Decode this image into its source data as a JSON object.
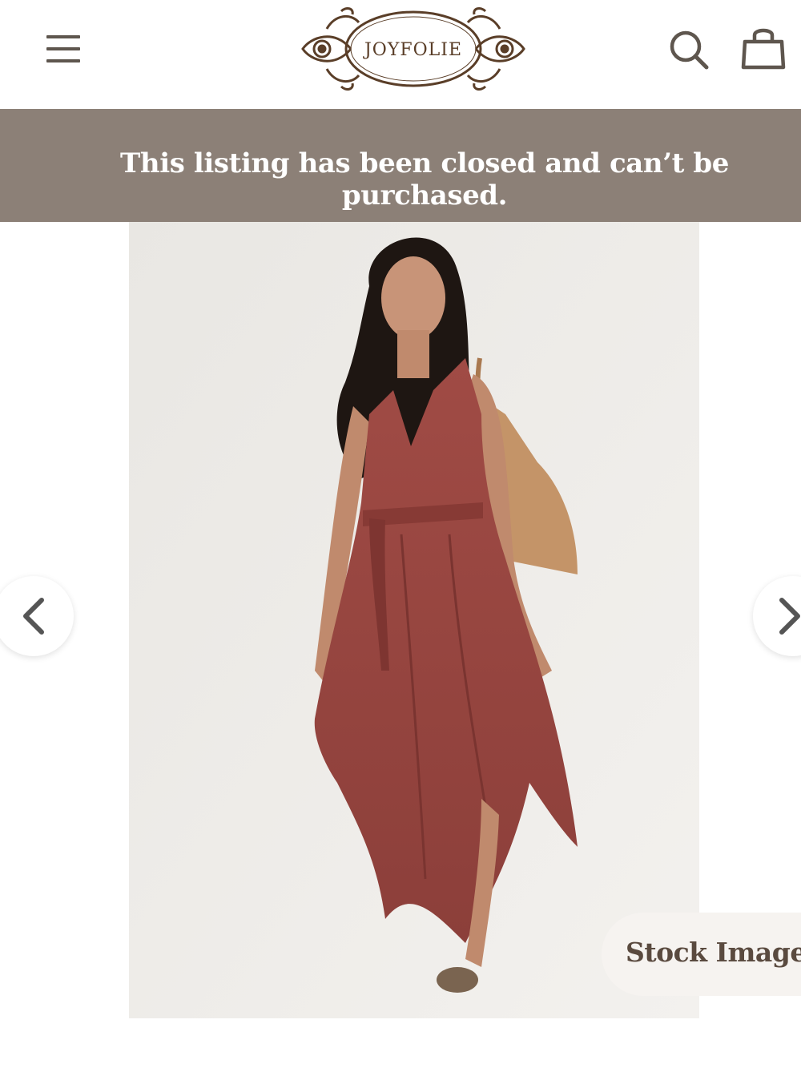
{
  "header": {
    "logo_text": "JOYFOLIE",
    "menu_icon": "hamburger-menu-icon",
    "search_icon": "search-icon",
    "cart_icon": "shopping-bag-icon"
  },
  "banner": {
    "message": "This listing has been closed and can’t be purchased."
  },
  "gallery": {
    "badge": "Stock Image",
    "prev_icon": "chevron-left-icon",
    "next_icon": "chevron-right-icon"
  },
  "colors": {
    "banner_bg": "#8c8077",
    "logo_brown": "#5a3e28",
    "dress_rust": "#9c4a44",
    "photo_bg": "#eceae6"
  }
}
